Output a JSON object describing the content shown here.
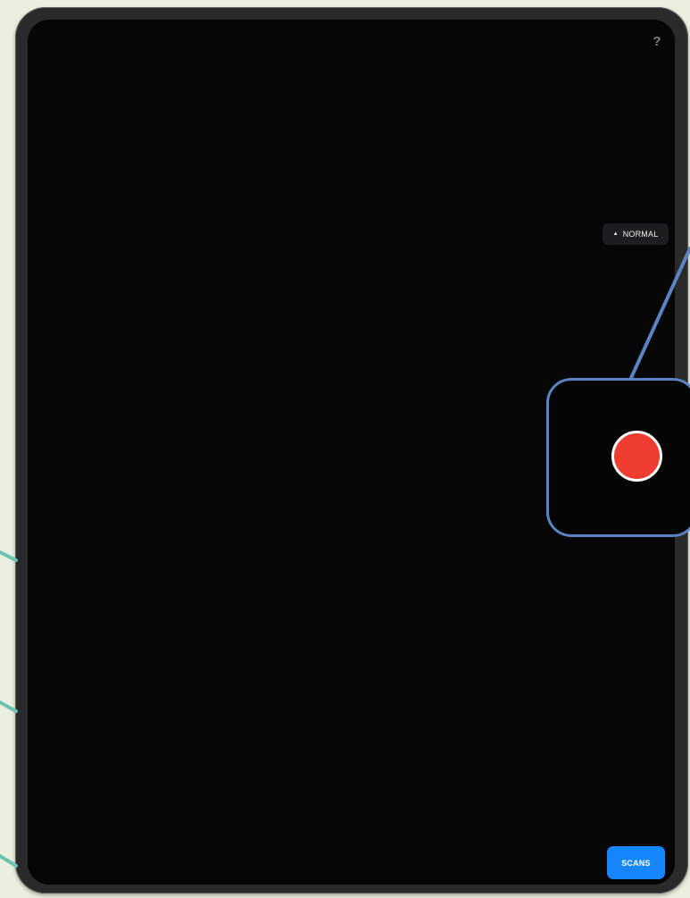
{
  "screen": {
    "help_label": "?",
    "mode_label": "NORMAL",
    "scans_label": "SCANS"
  },
  "icons": {
    "help": "question-icon",
    "mode": "triangle-up-icon",
    "record": "record-icon"
  },
  "colors": {
    "background": "#eaf0df",
    "frame": "#2a2a2a",
    "screen": "#060606",
    "mode_button_bg": "#1d1d1f",
    "scans_button": "#1686ff",
    "record_button": "#ef3d32",
    "callout_border": "#5a83c3",
    "teal_callout": "#6bc3b0"
  }
}
